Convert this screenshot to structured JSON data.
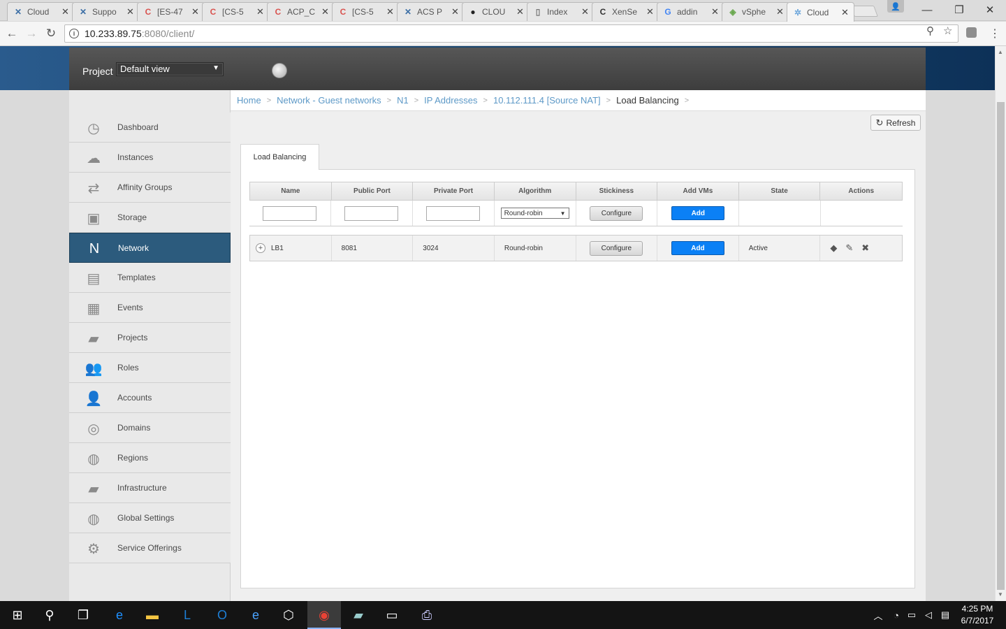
{
  "browser": {
    "tabs": [
      {
        "title": "Cloud",
        "icon": "x-logo-icon",
        "color": "#3b6ea5"
      },
      {
        "title": "Suppo",
        "icon": "x-logo-icon",
        "color": "#3b6ea5"
      },
      {
        "title": "[ES-47",
        "icon": "c-logo-icon",
        "color": "#d9534f"
      },
      {
        "title": "[CS-5",
        "icon": "c-logo-icon",
        "color": "#d9534f"
      },
      {
        "title": "ACP_C",
        "icon": "c-logo-icon",
        "color": "#d9534f"
      },
      {
        "title": "[CS-5",
        "icon": "c-logo-icon",
        "color": "#d9534f"
      },
      {
        "title": "ACS P",
        "icon": "x-logo-icon",
        "color": "#3b6ea5"
      },
      {
        "title": "CLOU",
        "icon": "github-icon",
        "color": "#222222"
      },
      {
        "title": "Index",
        "icon": "page-icon",
        "color": "#777777"
      },
      {
        "title": "XenSe",
        "icon": "c-logo-icon",
        "color": "#333333"
      },
      {
        "title": "addin",
        "icon": "google-icon",
        "color": "#4285f4"
      },
      {
        "title": "vSphe",
        "icon": "vsphere-icon",
        "color": "#6aa84f"
      },
      {
        "title": "Cloud",
        "icon": "cloud-icon",
        "color": "#6fa8dc"
      }
    ],
    "address": {
      "info": "i",
      "host": "10.233.89.75",
      "path": ":8080/client/"
    }
  },
  "header": {
    "project_label": "Project",
    "project_value": "Default view",
    "project_arrow": "▼"
  },
  "sidebar": {
    "items": [
      {
        "label": "Dashboard",
        "icon": "dashboard-icon",
        "glyph": "◷"
      },
      {
        "label": "Instances",
        "icon": "cloud-icon",
        "glyph": "☁"
      },
      {
        "label": "Affinity Groups",
        "icon": "affinity-icon",
        "glyph": "⇄"
      },
      {
        "label": "Storage",
        "icon": "storage-icon",
        "glyph": "▣"
      },
      {
        "label": "Network",
        "icon": "network-icon",
        "glyph": "N"
      },
      {
        "label": "Templates",
        "icon": "templates-icon",
        "glyph": "▤"
      },
      {
        "label": "Events",
        "icon": "calendar-icon",
        "glyph": "▦"
      },
      {
        "label": "Projects",
        "icon": "folder-icon",
        "glyph": "▰"
      },
      {
        "label": "Roles",
        "icon": "roles-icon",
        "glyph": "👥"
      },
      {
        "label": "Accounts",
        "icon": "user-icon",
        "glyph": "👤"
      },
      {
        "label": "Domains",
        "icon": "domains-icon",
        "glyph": "◎"
      },
      {
        "label": "Regions",
        "icon": "globe-icon",
        "glyph": "◍"
      },
      {
        "label": "Infrastructure",
        "icon": "infrastructure-icon",
        "glyph": "▰"
      },
      {
        "label": "Global Settings",
        "icon": "global-settings-icon",
        "glyph": "◍"
      },
      {
        "label": "Service Offerings",
        "icon": "gear-icon",
        "glyph": "⚙"
      }
    ],
    "active": "Network"
  },
  "breadcrumb": {
    "items": [
      "Home",
      "Network - Guest networks",
      "N1",
      "IP Addresses",
      "10.112.111.4 [Source NAT]",
      "Load Balancing"
    ],
    "separator": ">"
  },
  "refresh_label": "Refresh",
  "tab_label": "Load Balancing",
  "table": {
    "columns": [
      "Name",
      "Public Port",
      "Private Port",
      "Algorithm",
      "Stickiness",
      "Add VMs",
      "State",
      "Actions"
    ],
    "new_row": {
      "name": "",
      "public_port": "",
      "private_port": "",
      "algorithm": "Round-robin",
      "stickiness_button": "Configure",
      "add_vms_button": "Add"
    },
    "rows": [
      {
        "name": "LB1",
        "public_port": "8081",
        "private_port": "3024",
        "algorithm": "Round-robin",
        "stickiness_button": "Configure",
        "add_vms_button": "Add",
        "state": "Active"
      }
    ]
  },
  "taskbar": {
    "time": "4:25 PM",
    "date": "6/7/2017"
  }
}
